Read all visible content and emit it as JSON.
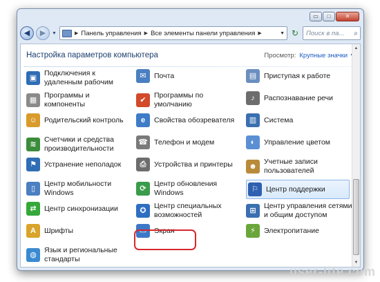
{
  "window": {
    "minimize_glyph": "▭",
    "maximize_glyph": "□",
    "close_glyph": "✕"
  },
  "toolbar": {
    "back_glyph": "◀",
    "forward_glyph": "▶",
    "history_glyph": "▼",
    "breadcrumb": [
      "Панель управления",
      "Все элементы панели управления"
    ],
    "breadcrumb_sep": "▶",
    "dropdown_glyph": "▼",
    "refresh_glyph": "↻",
    "search_placeholder": "Поиск в па...",
    "search_glyph": "⌕"
  },
  "header": {
    "title": "Настройка параметров компьютера",
    "view_label": "Просмотр:",
    "view_value": "Крупные значки",
    "view_caret": "▼"
  },
  "items": [
    {
      "label1": "Подключения к",
      "label2": "удаленным рабочим",
      "icon": "remote-desktop-icon",
      "color": "#2f6db5",
      "glyph": "▣"
    },
    {
      "label1": "Почта",
      "label2": "",
      "icon": "mail-icon",
      "color": "#4a7fc1",
      "glyph": "✉"
    },
    {
      "label1": "Приступая к работе",
      "label2": "",
      "icon": "getting-started-icon",
      "color": "#6a8fbf",
      "glyph": "▤"
    },
    {
      "label1": "Программы и",
      "label2": "компоненты",
      "icon": "programs-icon",
      "color": "#8a8a8a",
      "glyph": "▦"
    },
    {
      "label1": "Программы по",
      "label2": "умолчанию",
      "icon": "default-programs-icon",
      "color": "#d24a2a",
      "glyph": "✔"
    },
    {
      "label1": "Распознавание речи",
      "label2": "",
      "icon": "microphone-icon",
      "color": "#6d6d6d",
      "glyph": "♪"
    },
    {
      "label1": "Родительский контроль",
      "label2": "",
      "icon": "parental-control-icon",
      "color": "#d99b2b",
      "glyph": "☺"
    },
    {
      "label1": "Свойства обозревателя",
      "label2": "",
      "icon": "internet-options-icon",
      "color": "#3e7cc8",
      "glyph": "e"
    },
    {
      "label1": "Система",
      "label2": "",
      "icon": "system-icon",
      "color": "#3a6fb0",
      "glyph": "▥"
    },
    {
      "label1": "Счетчики и средства",
      "label2": "производительности",
      "icon": "performance-icon",
      "color": "#3b8c3b",
      "glyph": "≋"
    },
    {
      "label1": "Телефон и модем",
      "label2": "",
      "icon": "phone-modem-icon",
      "color": "#7a7a7a",
      "glyph": "☎"
    },
    {
      "label1": "Управление цветом",
      "label2": "",
      "icon": "color-management-icon",
      "color": "#5a8fd4",
      "glyph": "◐"
    },
    {
      "label1": "Устранение неполадок",
      "label2": "",
      "icon": "troubleshooting-icon",
      "color": "#2f6db5",
      "glyph": "⚑"
    },
    {
      "label1": "Устройства и принтеры",
      "label2": "",
      "icon": "printer-icon",
      "color": "#6d6d6d",
      "glyph": "⎙"
    },
    {
      "label1": "Учетные записи",
      "label2": "пользователей",
      "icon": "user-accounts-icon",
      "color": "#b88a3a",
      "glyph": "☻"
    },
    {
      "label1": "Центр мобильности",
      "label2": "Windows",
      "icon": "mobility-center-icon",
      "color": "#4a7fc1",
      "glyph": "▯"
    },
    {
      "label1": "Центр обновления",
      "label2": "Windows",
      "icon": "windows-update-icon",
      "color": "#3a9c4a",
      "glyph": "⟳"
    },
    {
      "label1": "Центр поддержки",
      "label2": "",
      "icon": "action-center-flag-icon",
      "color": "#2f5fb0",
      "glyph": "⚐"
    },
    {
      "label1": "Центр синхронизации",
      "label2": "",
      "icon": "sync-center-icon",
      "color": "#35a83a",
      "glyph": "⇄"
    },
    {
      "label1": "Центр специальных",
      "label2": "возможностей",
      "icon": "ease-of-access-icon",
      "color": "#2e6fc2",
      "glyph": "✪"
    },
    {
      "label1": "Центр управления сетями",
      "label2": "и общим доступом",
      "icon": "network-center-icon",
      "color": "#3a6fb0",
      "glyph": "⊞"
    },
    {
      "label1": "Шрифты",
      "label2": "",
      "icon": "fonts-icon",
      "color": "#d9a42b",
      "glyph": "A"
    },
    {
      "label1": "Экран",
      "label2": "",
      "icon": "display-monitor-icon",
      "color": "#3c78c8",
      "glyph": "▭"
    },
    {
      "label1": "Электропитание",
      "label2": "",
      "icon": "power-options-icon",
      "color": "#6aa63a",
      "glyph": "⚡"
    },
    {
      "label1": "Язык и региональные",
      "label2": "стандарты",
      "icon": "region-language-icon",
      "color": "#3a8ad0",
      "glyph": "◍"
    }
  ],
  "scrollbar": {
    "up_glyph": "▲",
    "down_glyph": "▼"
  },
  "watermark": "user-life.com"
}
